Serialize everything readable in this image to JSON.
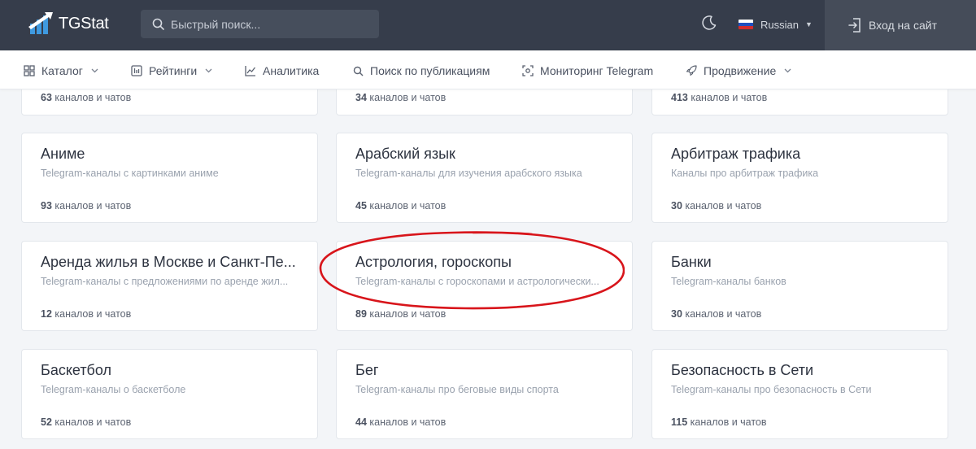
{
  "header": {
    "logo_text": "TGStat",
    "search_placeholder": "Быстрый поиск...",
    "language": "Russian",
    "login_label": "Вход на сайт"
  },
  "nav": {
    "items": [
      {
        "label": "Каталог",
        "icon": "grid-icon",
        "has_dropdown": true
      },
      {
        "label": "Рейтинги",
        "icon": "rating-icon",
        "has_dropdown": true
      },
      {
        "label": "Аналитика",
        "icon": "chart-icon",
        "has_dropdown": false
      },
      {
        "label": "Поиск по публикациям",
        "icon": "search-icon",
        "has_dropdown": false
      },
      {
        "label": "Мониторинг Telegram",
        "icon": "monitor-icon",
        "has_dropdown": false
      },
      {
        "label": "Продвижение",
        "icon": "rocket-icon",
        "has_dropdown": true
      }
    ]
  },
  "partial_row": [
    {
      "count": "63",
      "count_suffix": "каналов и чатов"
    },
    {
      "count": "34",
      "count_suffix": "каналов и чатов"
    },
    {
      "count": "413",
      "count_suffix": "каналов и чатов"
    }
  ],
  "categories": [
    {
      "title": "Аниме",
      "description": "Telegram-каналы с картинками аниме",
      "count": "93",
      "count_suffix": "каналов и чатов"
    },
    {
      "title": "Арабский язык",
      "description": "Telegram-каналы для изучения арабского языка",
      "count": "45",
      "count_suffix": "каналов и чатов"
    },
    {
      "title": "Арбитраж трафика",
      "description": "Каналы про арбитраж трафика",
      "count": "30",
      "count_suffix": "каналов и чатов"
    },
    {
      "title": "Аренда жилья в Москве и Санкт-Пе...",
      "description": "Telegram-каналы с предложениями по аренде жил...",
      "count": "12",
      "count_suffix": "каналов и чатов"
    },
    {
      "title": "Астрология, гороскопы",
      "description": "Telegram-каналы с гороскопами и астрологически...",
      "count": "89",
      "count_suffix": "каналов и чатов"
    },
    {
      "title": "Банки",
      "description": "Telegram-каналы банков",
      "count": "30",
      "count_suffix": "каналов и чатов"
    },
    {
      "title": "Баскетбол",
      "description": "Telegram-каналы о баскетболе",
      "count": "52",
      "count_suffix": "каналов и чатов"
    },
    {
      "title": "Бег",
      "description": "Telegram-каналы про беговые виды спорта",
      "count": "44",
      "count_suffix": "каналов и чатов"
    },
    {
      "title": "Безопасность в Сети",
      "description": "Telegram-каналы про безопасность в Сети",
      "count": "115",
      "count_suffix": "каналов и чатов"
    }
  ],
  "colors": {
    "topbar": "#363d4b",
    "highlight_ring": "#d8151b"
  }
}
